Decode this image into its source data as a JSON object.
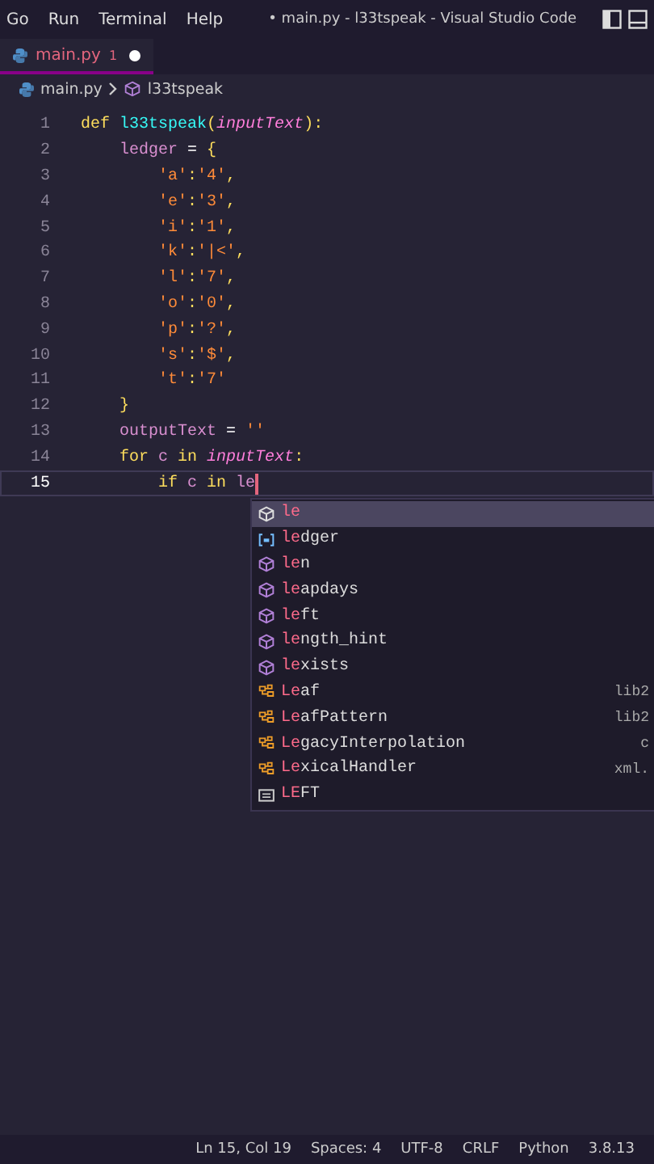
{
  "menu": [
    "Go",
    "Run",
    "Terminal",
    "Help"
  ],
  "window": {
    "title": "• main.py - l33tspeak - Visual Studio Code"
  },
  "tabs": [
    {
      "label": "main.py",
      "problems": "1",
      "modified": true,
      "selected": true
    }
  ],
  "breadcrumb": {
    "file": "main.py",
    "symbol": "l33tspeak"
  },
  "lines": [
    {
      "number": "1",
      "current": false,
      "tokens": [
        {
          "kind": "keyword",
          "text": "def "
        },
        {
          "kind": "function",
          "text": "l33tspeak"
        },
        {
          "kind": "punct",
          "text": "("
        },
        {
          "kind": "param",
          "text": "inputText"
        },
        {
          "kind": "punct",
          "text": "):"
        }
      ]
    },
    {
      "number": "2",
      "current": false,
      "tokens": [
        {
          "kind": "variable",
          "text": "    ledger"
        },
        {
          "kind": "operator",
          "text": " = "
        },
        {
          "kind": "keyword",
          "text": "{"
        }
      ]
    },
    {
      "number": "3",
      "current": false,
      "tokens": [
        {
          "kind": "string",
          "text": "        'a'"
        },
        {
          "kind": "punct",
          "text": ":"
        },
        {
          "kind": "string",
          "text": "'4'"
        },
        {
          "kind": "punct",
          "text": ","
        }
      ]
    },
    {
      "number": "4",
      "current": false,
      "tokens": [
        {
          "kind": "string",
          "text": "        'e'"
        },
        {
          "kind": "punct",
          "text": ":"
        },
        {
          "kind": "string",
          "text": "'3'"
        },
        {
          "kind": "punct",
          "text": ","
        }
      ]
    },
    {
      "number": "5",
      "current": false,
      "tokens": [
        {
          "kind": "string",
          "text": "        'i'"
        },
        {
          "kind": "punct",
          "text": ":"
        },
        {
          "kind": "string",
          "text": "'1'"
        },
        {
          "kind": "punct",
          "text": ","
        }
      ]
    },
    {
      "number": "6",
      "current": false,
      "tokens": [
        {
          "kind": "string",
          "text": "        'k'"
        },
        {
          "kind": "punct",
          "text": ":"
        },
        {
          "kind": "string",
          "text": "'|<'"
        },
        {
          "kind": "punct",
          "text": ","
        }
      ]
    },
    {
      "number": "7",
      "current": false,
      "tokens": [
        {
          "kind": "string",
          "text": "        'l'"
        },
        {
          "kind": "punct",
          "text": ":"
        },
        {
          "kind": "string",
          "text": "'7'"
        },
        {
          "kind": "punct",
          "text": ","
        }
      ]
    },
    {
      "number": "8",
      "current": false,
      "tokens": [
        {
          "kind": "string",
          "text": "        'o'"
        },
        {
          "kind": "punct",
          "text": ":"
        },
        {
          "kind": "string",
          "text": "'0'"
        },
        {
          "kind": "punct",
          "text": ","
        }
      ]
    },
    {
      "number": "9",
      "current": false,
      "tokens": [
        {
          "kind": "string",
          "text": "        'p'"
        },
        {
          "kind": "punct",
          "text": ":"
        },
        {
          "kind": "string",
          "text": "'?'"
        },
        {
          "kind": "punct",
          "text": ","
        }
      ]
    },
    {
      "number": "10",
      "current": false,
      "tokens": [
        {
          "kind": "string",
          "text": "        's'"
        },
        {
          "kind": "punct",
          "text": ":"
        },
        {
          "kind": "string",
          "text": "'$'"
        },
        {
          "kind": "punct",
          "text": ","
        }
      ]
    },
    {
      "number": "11",
      "current": false,
      "tokens": [
        {
          "kind": "string",
          "text": "        't'"
        },
        {
          "kind": "punct",
          "text": ":"
        },
        {
          "kind": "string",
          "text": "'7'"
        }
      ]
    },
    {
      "number": "12",
      "current": false,
      "tokens": [
        {
          "kind": "keyword",
          "text": "    }"
        }
      ]
    },
    {
      "number": "13",
      "current": false,
      "tokens": [
        {
          "kind": "variable",
          "text": "    outputText"
        },
        {
          "kind": "operator",
          "text": " = "
        },
        {
          "kind": "string",
          "text": "''"
        }
      ]
    },
    {
      "number": "14",
      "current": false,
      "tokens": [
        {
          "kind": "keyword",
          "text": "    for "
        },
        {
          "kind": "variable",
          "text": "c "
        },
        {
          "kind": "keyword",
          "text": "in "
        },
        {
          "kind": "param",
          "text": "inputText"
        },
        {
          "kind": "punct",
          "text": ":"
        }
      ]
    },
    {
      "number": "15",
      "current": true,
      "tokens": [
        {
          "kind": "keyword",
          "text": "        if "
        },
        {
          "kind": "variable",
          "text": "c "
        },
        {
          "kind": "keyword",
          "text": "in "
        },
        {
          "kind": "variable",
          "text": "le"
        }
      ]
    }
  ],
  "suggestions": [
    {
      "kind": "symbol",
      "match": "le",
      "selected": true
    },
    {
      "kind": "variable",
      "match": "le",
      "rest": "dger",
      "selected": false
    },
    {
      "kind": "symbol",
      "match": "le",
      "rest": "n",
      "selected": false
    },
    {
      "kind": "symbol",
      "match": "le",
      "rest": "apdays",
      "selected": false
    },
    {
      "kind": "symbol",
      "match": "le",
      "rest": "ft",
      "selected": false
    },
    {
      "kind": "symbol",
      "match": "le",
      "rest": "ngth_hint",
      "selected": false
    },
    {
      "kind": "symbol",
      "match": "le",
      "rest": "xists",
      "selected": false
    },
    {
      "kind": "class",
      "match": "Le",
      "rest": "af",
      "detail": "lib2",
      "selected": false
    },
    {
      "kind": "class",
      "match": "Le",
      "rest": "afPattern",
      "detail": "lib2",
      "selected": false
    },
    {
      "kind": "class",
      "match": "Le",
      "rest": "gacyInterpolation",
      "detail": "c",
      "selected": false
    },
    {
      "kind": "class",
      "match": "Le",
      "rest": "xicalHandler",
      "detail": "xml.",
      "selected": false
    },
    {
      "kind": "constant",
      "match": "LE",
      "rest": "FT",
      "selected": false
    }
  ],
  "status_bar": [
    "Ln 15, Col 19",
    "Spaces: 4",
    "UTF-8",
    "CRLF",
    "Python",
    "3.8.13"
  ]
}
